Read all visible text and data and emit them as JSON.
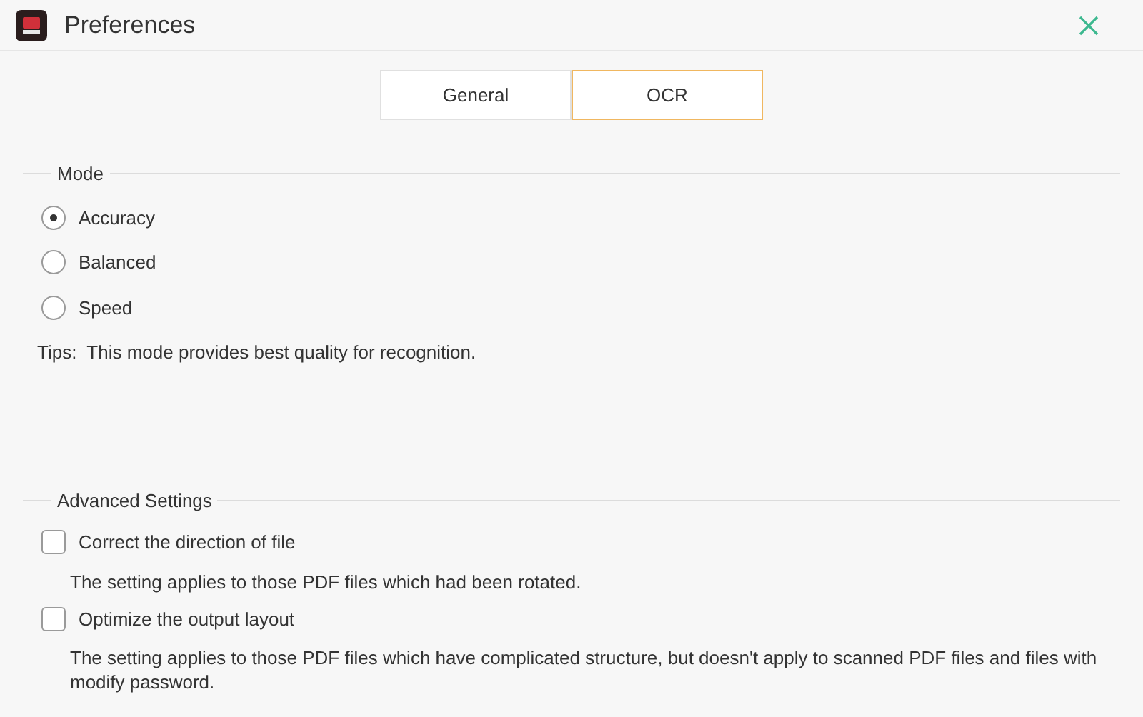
{
  "window": {
    "title": "Preferences"
  },
  "tabs": [
    {
      "label": "General",
      "selected": false
    },
    {
      "label": "OCR",
      "selected": true
    }
  ],
  "mode": {
    "heading": "Mode",
    "options": [
      {
        "label": "Accuracy",
        "selected": true
      },
      {
        "label": "Balanced",
        "selected": false
      },
      {
        "label": "Speed",
        "selected": false
      }
    ],
    "tip": "Tips:  This mode provides best quality for recognition."
  },
  "advanced": {
    "heading": "Advanced Settings",
    "options": [
      {
        "label": "Correct the direction of file",
        "checked": false,
        "description": "The setting applies to those PDF files which had been rotated."
      },
      {
        "label": "Optimize the output layout",
        "checked": false,
        "description": "The setting applies to those PDF files which have complicated structure, but doesn't apply to scanned PDF files and files with modify password."
      }
    ]
  }
}
